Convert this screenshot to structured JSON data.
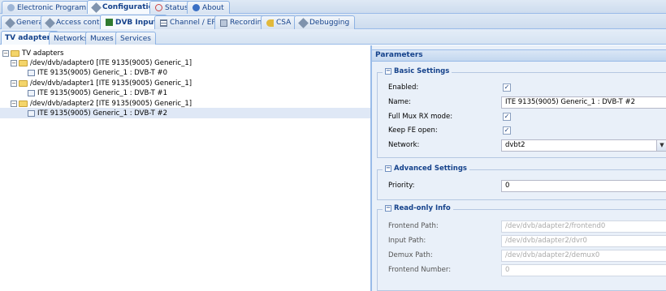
{
  "top_tabs": [
    {
      "label": "Electronic Program Guide",
      "icon": "epg-icon"
    },
    {
      "label": "Configuration",
      "icon": "wrench-icon"
    },
    {
      "label": "Status",
      "icon": "eye-icon"
    },
    {
      "label": "About",
      "icon": "info-icon"
    }
  ],
  "config_tabs": [
    {
      "label": "General",
      "icon": "wrench-icon"
    },
    {
      "label": "Access control",
      "icon": "wrench-icon"
    },
    {
      "label": "DVB Inputs",
      "icon": "dvb-icon"
    },
    {
      "label": "Channel / EPG",
      "icon": "list-icon"
    },
    {
      "label": "Recording",
      "icon": "recording-icon"
    },
    {
      "label": "CSA",
      "icon": "key-icon"
    },
    {
      "label": "Debugging",
      "icon": "wrench-icon"
    }
  ],
  "sub_tabs": [
    "TV adapters",
    "Networks",
    "Muxes",
    "Services"
  ],
  "tree": {
    "root": "TV adapters",
    "adapters": [
      {
        "label": "/dev/dvb/adapter0 [ITE 9135(9005) Generic_1]",
        "child": "ITE 9135(9005) Generic_1 : DVB-T #0"
      },
      {
        "label": "/dev/dvb/adapter1 [ITE 9135(9005) Generic_1]",
        "child": "ITE 9135(9005) Generic_1 : DVB-T #1"
      },
      {
        "label": "/dev/dvb/adapter2 [ITE 9135(9005) Generic_1]",
        "child": "ITE 9135(9005) Generic_1 : DVB-T #2"
      }
    ]
  },
  "parameters": {
    "title": "Parameters",
    "basic": {
      "title": "Basic Settings",
      "enabled_label": "Enabled:",
      "enabled": true,
      "name_label": "Name:",
      "name_value": "ITE 9135(9005) Generic_1 : DVB-T #2",
      "fullmux_label": "Full Mux RX mode:",
      "fullmux": true,
      "keepfe_label": "Keep FE open:",
      "keepfe": true,
      "network_label": "Network:",
      "network_value": "dvbt2"
    },
    "advanced": {
      "title": "Advanced Settings",
      "priority_label": "Priority:",
      "priority_value": "0"
    },
    "readonly": {
      "title": "Read-only Info",
      "frontend_path_label": "Frontend Path:",
      "frontend_path_value": "/dev/dvb/adapter2/frontend0",
      "input_path_label": "Input Path:",
      "input_path_value": "/dev/dvb/adapter2/dvr0",
      "demux_path_label": "Demux Path:",
      "demux_path_value": "/dev/dvb/adapter2/demux0",
      "frontend_number_label": "Frontend Number:",
      "frontend_number_value": "0"
    }
  },
  "glyphs": {
    "checked": "✓",
    "collapse": "−",
    "expand": "−",
    "arrow": "▼"
  }
}
